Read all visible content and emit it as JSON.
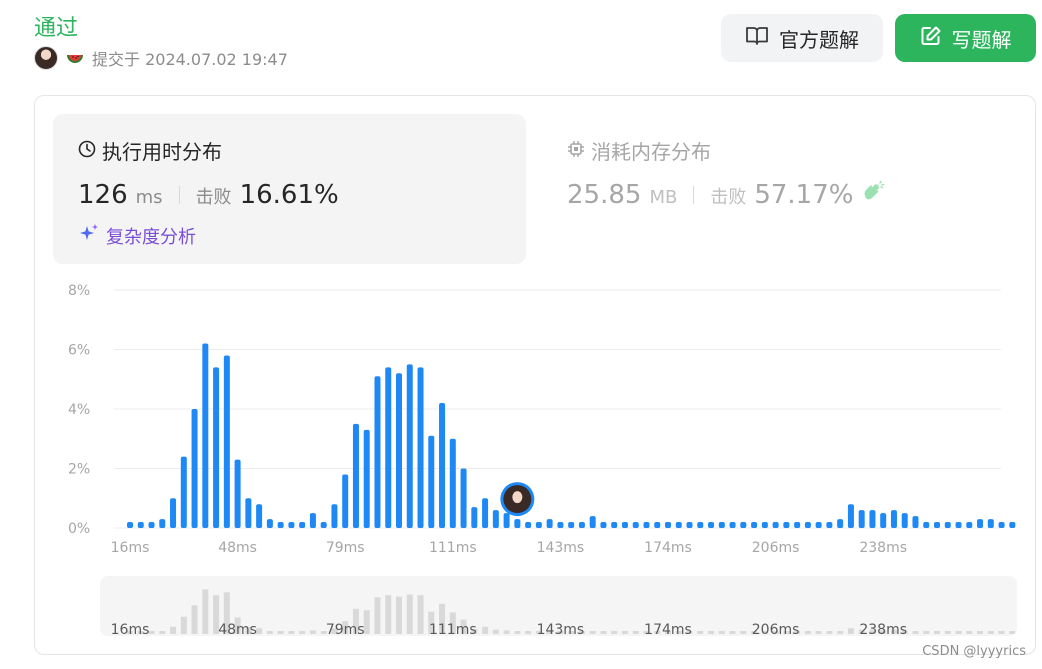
{
  "header": {
    "status": "通过",
    "submitted": "提交于 2024.07.02 19:47",
    "official_btn": "官方题解",
    "write_btn": "写题解"
  },
  "runtime": {
    "title": "执行用时分布",
    "value": "126",
    "unit": "ms",
    "beat_label": "击败",
    "beat": "16.61%",
    "complexity_link": "复杂度分析"
  },
  "memory": {
    "title": "消耗内存分布",
    "value": "25.85",
    "unit": "MB",
    "beat_label": "击败",
    "beat": "57.17%"
  },
  "colors": {
    "accent_green": "#2db55d",
    "bar_blue": "#1e88f5",
    "purple": "#7a4fd6"
  },
  "watermark": "CSDN @lyyyrics",
  "chart_data": {
    "type": "bar",
    "ylabel": "",
    "xlabel": "",
    "yticks": [
      "0%",
      "2%",
      "4%",
      "6%",
      "8%"
    ],
    "ylim": [
      0,
      8
    ],
    "xticks": [
      "16ms",
      "48ms",
      "79ms",
      "111ms",
      "143ms",
      "174ms",
      "206ms",
      "238ms"
    ],
    "grid": true,
    "user_bar_index": 36,
    "values": [
      0.2,
      0.2,
      0.2,
      0.3,
      1.0,
      2.4,
      4.0,
      6.2,
      5.4,
      5.8,
      2.3,
      1.0,
      0.8,
      0.3,
      0.2,
      0.2,
      0.2,
      0.5,
      0.2,
      0.8,
      1.8,
      3.5,
      3.3,
      5.1,
      5.4,
      5.2,
      5.5,
      5.4,
      3.1,
      4.2,
      3.0,
      2.0,
      0.7,
      1.0,
      0.6,
      0.5,
      0.3,
      0.2,
      0.2,
      0.3,
      0.2,
      0.2,
      0.2,
      0.4,
      0.2,
      0.2,
      0.2,
      0.2,
      0.2,
      0.2,
      0.2,
      0.2,
      0.2,
      0.2,
      0.2,
      0.2,
      0.2,
      0.2,
      0.2,
      0.2,
      0.2,
      0.2,
      0.2,
      0.2,
      0.2,
      0.2,
      0.3,
      0.8,
      0.6,
      0.6,
      0.5,
      0.6,
      0.5,
      0.4,
      0.2,
      0.2,
      0.2,
      0.2,
      0.2,
      0.3,
      0.3,
      0.2,
      0.2
    ]
  }
}
